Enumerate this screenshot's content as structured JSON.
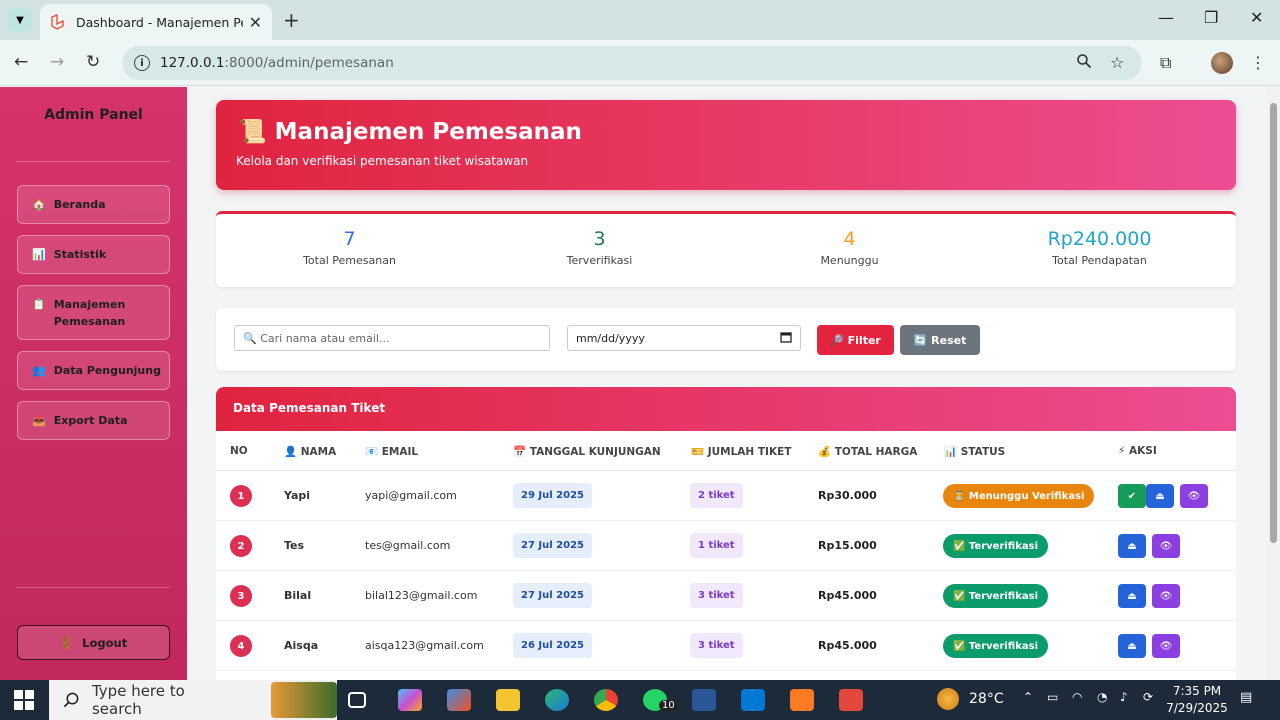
{
  "browser": {
    "tab_title": "Dashboard - Manajemen Pemesanan",
    "url_host": "127.0.0.1",
    "url_path": ":8000/admin/pemesanan"
  },
  "sidebar": {
    "title": "Admin Panel",
    "items": [
      {
        "icon": "🏠",
        "label": "Beranda"
      },
      {
        "icon": "📊",
        "label": "Statistik"
      },
      {
        "icon": "📋",
        "label": "Manajemen Pemesanan"
      },
      {
        "icon": "👥",
        "label": "Data Pengunjung"
      },
      {
        "icon": "📤",
        "label": "Export Data"
      }
    ],
    "logout_icon": "🚪",
    "logout_label": "Logout"
  },
  "hero": {
    "icon": "📜",
    "title": "Manajemen Pemesanan",
    "subtitle": "Kelola dan verifikasi pemesanan tiket wisatawan"
  },
  "stats": [
    {
      "value": "7",
      "label": "Total Pemesanan",
      "color": "#2f6fd6"
    },
    {
      "value": "3",
      "label": "Terverifikasi",
      "color": "#1f7a4c"
    },
    {
      "value": "4",
      "label": "Menunggu",
      "color": "#f0a020"
    },
    {
      "value": "Rp240.000",
      "label": "Total Pendapatan",
      "color": "#22a6c8"
    }
  ],
  "filter": {
    "search_placeholder": "🔍 Cari nama atau email...",
    "date_placeholder": "mm/dd/yyyy",
    "filter_label": "🔎 Filter",
    "reset_label": "🔄 Reset"
  },
  "table": {
    "title": "Data Pemesanan Tiket",
    "headers": [
      "NO",
      "👤 NAMA",
      "📧 EMAIL",
      "📅 TANGGAL KUNJUNGAN",
      "🎫 JUMLAH TIKET",
      "💰 TOTAL HARGA",
      "📊 STATUS",
      "⚡ AKSI"
    ],
    "rows": [
      {
        "no": "1",
        "nama": "Yapi",
        "email": "yapi@gmail.com",
        "tanggal": "29 Jul 2025",
        "tiket": "2 tiket",
        "harga": "Rp30.000",
        "status": "⏳ Menunggu Verifikasi",
        "status_color": "#e8850c"
      },
      {
        "no": "2",
        "nama": "Tes",
        "email": "tes@gmail.com",
        "tanggal": "27 Jul 2025",
        "tiket": "1 tiket",
        "harga": "Rp15.000",
        "status": "✅ Terverifikasi",
        "status_color": "#0c9b6a"
      },
      {
        "no": "3",
        "nama": "Bilal",
        "email": "bilal123@gmail.com",
        "tanggal": "27 Jul 2025",
        "tiket": "3 tiket",
        "harga": "Rp45.000",
        "status": "✅ Terverifikasi",
        "status_color": "#0c9b6a"
      },
      {
        "no": "4",
        "nama": "Aisqa",
        "email": "aisqa123@gmail.com",
        "tanggal": "26 Jul 2025",
        "tiket": "3 tiket",
        "harga": "Rp45.000",
        "status": "✅ Terverifikasi",
        "status_color": "#0c9b6a"
      }
    ]
  },
  "taskbar": {
    "search_placeholder": "Type here to search",
    "weather": "28°C",
    "time": "7:35 PM",
    "date": "7/29/2025",
    "whatsapp_badge": "10"
  }
}
